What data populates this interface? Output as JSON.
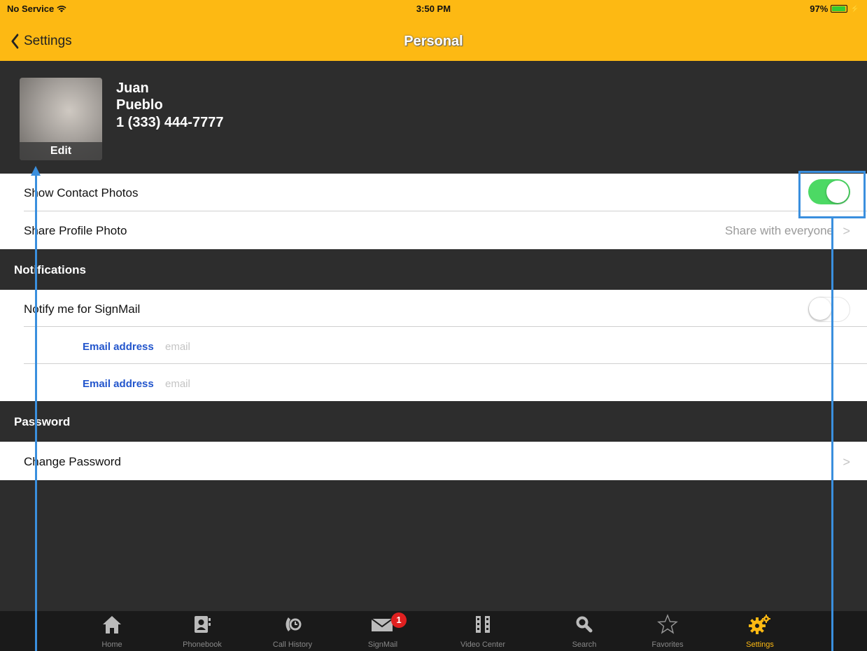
{
  "status_bar": {
    "carrier": "No Service",
    "time": "3:50 PM",
    "battery_text": "97%",
    "battery_level": 0.97
  },
  "nav": {
    "back_label": "Settings",
    "title": "Personal"
  },
  "profile": {
    "first_name": "Juan",
    "last_name": "Pueblo",
    "phone": "1 (333) 444-7777",
    "edit_label": "Edit"
  },
  "rows": {
    "show_contact_photos": {
      "label": "Show Contact Photos",
      "enabled": true
    },
    "share_profile_photo": {
      "label": "Share Profile Photo",
      "value": "Share with everyone"
    }
  },
  "notifications": {
    "header": "Notifications",
    "notify_signmail": {
      "label": "Notify me for SignMail",
      "enabled": false
    },
    "email_fields": [
      {
        "label": "Email address",
        "placeholder": "email"
      },
      {
        "label": "Email address",
        "placeholder": "email"
      }
    ]
  },
  "password": {
    "header": "Password",
    "change_label": "Change Password"
  },
  "tabs": [
    {
      "label": "Home",
      "icon": "home-icon"
    },
    {
      "label": "Phonebook",
      "icon": "phonebook-icon"
    },
    {
      "label": "Call History",
      "icon": "call-history-icon"
    },
    {
      "label": "SignMail",
      "icon": "signmail-icon",
      "badge": "1"
    },
    {
      "label": "Video Center",
      "icon": "video-center-icon"
    },
    {
      "label": "Search",
      "icon": "search-icon"
    },
    {
      "label": "Favorites",
      "icon": "star-icon"
    },
    {
      "label": "Settings",
      "icon": "gear-icon",
      "active": true
    }
  ],
  "colors": {
    "accent": "#fdb913",
    "toggle_on": "#4cd964",
    "annotation": "#3a8fde",
    "link_blue": "#2255cc"
  }
}
